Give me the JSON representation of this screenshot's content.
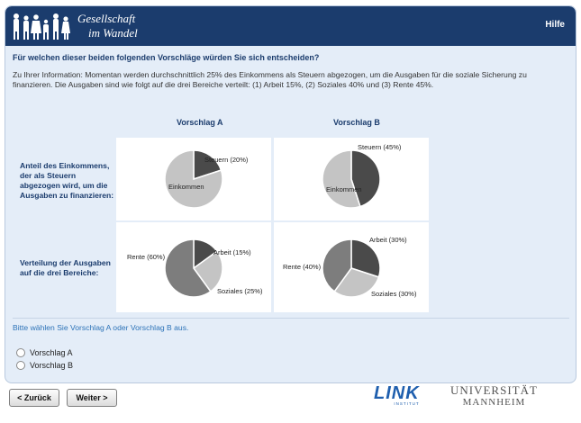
{
  "header": {
    "brand_line1": "Gesellschaft",
    "brand_line2": "im Wandel",
    "help_label": "Hilfe"
  },
  "question": "Für welchen dieser beiden folgenden Vorschläge würden Sie sich entscheiden?",
  "info": "Zu Ihrer Information: Momentan werden durchschnittlich 25% des Einkommens als Steuern abgezogen, um die Ausgaben für die soziale Sicherung zu finanzieren. Die Ausgaben sind wie folgt auf die drei Bereiche verteilt: (1) Arbeit 15%, (2) Soziales 40% und (3) Rente 45%.",
  "columns": [
    "Vorschlag A",
    "Vorschlag B"
  ],
  "row_labels": [
    "Anteil des Einkommens, der als Steuern abgezogen wird, um die Ausgaben zu finanzieren:",
    "Verteilung der Ausgaben auf die drei Bereiche:"
  ],
  "colors": {
    "header": "#1b3c6d",
    "dark": "#4a4a4a",
    "medium": "#7d7d7d",
    "light": "#c4c4c4"
  },
  "chart_data": [
    {
      "type": "pie",
      "slices": [
        {
          "label": "Steuern (20%)",
          "value": 20,
          "color": "#4a4a4a"
        },
        {
          "label": "Einkommen",
          "value": 80,
          "color": "#c4c4c4"
        }
      ]
    },
    {
      "type": "pie",
      "slices": [
        {
          "label": "Steuern (45%)",
          "value": 45,
          "color": "#4a4a4a"
        },
        {
          "label": "Einkommen",
          "value": 55,
          "color": "#c4c4c4"
        }
      ]
    },
    {
      "type": "pie",
      "slices": [
        {
          "label": "Arbeit (15%)",
          "value": 15,
          "color": "#4a4a4a"
        },
        {
          "label": "Soziales (25%)",
          "value": 25,
          "color": "#c4c4c4"
        },
        {
          "label": "Rente (60%)",
          "value": 60,
          "color": "#7d7d7d"
        }
      ]
    },
    {
      "type": "pie",
      "slices": [
        {
          "label": "Arbeit (30%)",
          "value": 30,
          "color": "#4a4a4a"
        },
        {
          "label": "Soziales (30%)",
          "value": 30,
          "color": "#c4c4c4"
        },
        {
          "label": "Rente (40%)",
          "value": 40,
          "color": "#7d7d7d"
        }
      ]
    }
  ],
  "instruction": "Bitte wählen Sie Vorschlag A oder Vorschlag B aus.",
  "options": [
    "Vorschlag A",
    "Vorschlag B"
  ],
  "buttons": {
    "back": "< Zurück",
    "next": "Weiter >"
  },
  "logos": {
    "link": "LINK",
    "link_sub": "INSTITUT",
    "uni_line1": "UNIVERSITÄT",
    "uni_line2": "MANNHEIM"
  }
}
